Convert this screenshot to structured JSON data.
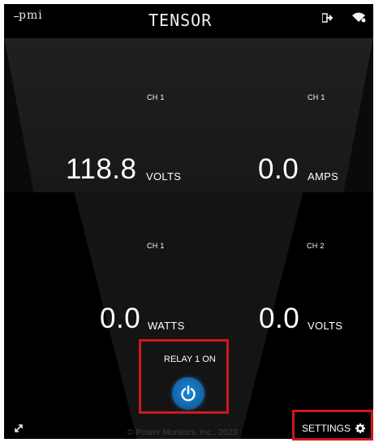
{
  "header": {
    "brand_left": "pmi",
    "brand_center": "TENSOR",
    "icons": [
      "logout-icon",
      "wifi-icon"
    ]
  },
  "readings": [
    {
      "channel": "CH 1",
      "value": "118.8",
      "unit": "VOLTS"
    },
    {
      "channel": "CH 1",
      "value": "0.0",
      "unit": "AMPS"
    },
    {
      "channel": "CH 1",
      "value": "0.0",
      "unit": "WATTS"
    },
    {
      "channel": "CH 2",
      "value": "0.0",
      "unit": "VOLTS"
    }
  ],
  "relay": {
    "label": "RELAY 1 ON",
    "icon": "power-icon",
    "color": "#1a86d6"
  },
  "footer": {
    "copyright": "© Power Monitors, Inc., 2023",
    "settings_label": "SETTINGS",
    "expand_icon": "expand-icon",
    "settings_icon": "gear-icon"
  },
  "colors": {
    "background": "#000000",
    "highlight": "#d0161f",
    "text": "#ffffff"
  }
}
